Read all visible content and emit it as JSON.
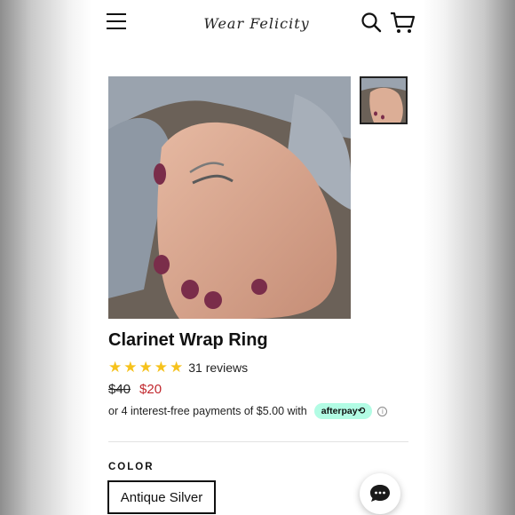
{
  "header": {
    "logo_text": "Wear Felicity",
    "menu_icon": "hamburger-menu-icon",
    "search_icon": "search-icon",
    "cart_icon": "cart-icon"
  },
  "product": {
    "title": "Clarinet Wrap Ring",
    "rating": {
      "stars": 5,
      "reviews_label": "31 reviews"
    },
    "price_original": "$40",
    "price_sale": "$20",
    "installments_text": "or 4 interest-free payments of $5.00 with",
    "afterpay_label": "afterpay⟲",
    "info_icon": "ⓘ"
  },
  "options": {
    "color_label": "COLOR",
    "selected_color": "Antique Silver"
  },
  "colors": {
    "sale_price": "#c1272d",
    "afterpay_badge": "#b2fce4",
    "star": "#f6c21c"
  }
}
